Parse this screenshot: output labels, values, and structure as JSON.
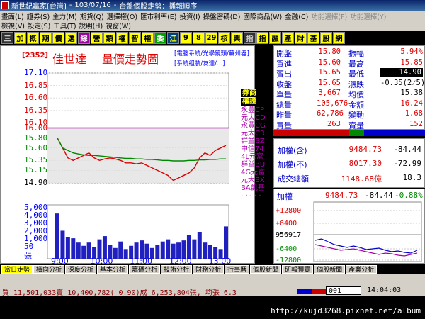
{
  "window": {
    "title": "新世紀贏家",
    "market": "[台灣]",
    "date": "103/07/16",
    "subtitle": "台盤個股走勢：播報順序"
  },
  "menu": {
    "row1": [
      "畫面(L)",
      "證券(S)",
      "主力(M)",
      "期貨(Q)",
      "選擇權(O)",
      "匯市利率(E)",
      "投資(I)",
      "操盤密碼(D)",
      "國際商品(W)",
      "金融(C)",
      "功能選擇(F)",
      "功能選擇(Y)"
    ],
    "row2": [
      "檢視(V)",
      "設定(S)",
      "工具(T)",
      "說明(H)",
      "視窗(W)"
    ]
  },
  "toolbar": [
    "三",
    "加",
    "概",
    "期",
    "價",
    "選",
    "綜",
    "營",
    "類",
    "權",
    "智",
    "權",
    "委",
    "江",
    "9",
    "8",
    "29",
    "核",
    "興",
    "指",
    "指",
    "融",
    "產",
    "財",
    "基",
    "股",
    "網"
  ],
  "stock": {
    "id": "[2352]",
    "name": "佳世達",
    "chart_title": "量價走勢圖",
    "links": [
      "[電腦系統/光學鏡頭/蘇州器]",
      "[系統組裝/友達/...]"
    ]
  },
  "quote": {
    "rows": [
      {
        "l1": "開盤",
        "v1": "15.80",
        "l2": "振幅",
        "v2": "5.94%"
      },
      {
        "l1": "買進",
        "v1": "15.60",
        "l2": "最高",
        "v2": "15.85"
      },
      {
        "l1": "賣出",
        "v1": "15.65",
        "l2": "最低",
        "v2": "14.90"
      },
      {
        "l1": "收盤",
        "v1": "15.65",
        "l2": "漲跌",
        "v2": "-0.35(2⁄5)"
      },
      {
        "l1": "單量",
        "v1": "3,667",
        "l2": "均價",
        "v2": "15.38"
      },
      {
        "l1": "總量",
        "v1": "105,676",
        "l2": "金額",
        "v2": "16.24"
      },
      {
        "l1": "昨量",
        "v1": "62,786",
        "l2": "變動",
        "v2": "1.68"
      },
      {
        "l1": "買量",
        "v1": "263",
        "l2": "賣量",
        "v2": "152"
      }
    ]
  },
  "index": {
    "rows": [
      {
        "label": "加權(含)",
        "value": "9484.73",
        "change": "-84.44"
      },
      {
        "label": "加權(不)",
        "value": "8017.30",
        "change": "-72.99"
      },
      {
        "label": "成交總額",
        "value": "1148.68億",
        "change": "18.3"
      }
    ]
  },
  "mini": {
    "label": "加權",
    "value": "9484.73",
    "change": "-84.44",
    "pct": "-0.88%",
    "ylabels": [
      "+12800",
      "+6400",
      "956917",
      "-6400",
      "-12800"
    ]
  },
  "brokers": {
    "header1": "券商",
    "header2": "權證",
    "list": [
      "永豐CP",
      "元大CD",
      "永豐CG",
      "元大CR",
      "群益BZ",
      "中信74",
      "4L元富",
      "群益BU",
      "4G元富",
      "元大BX",
      "BA凱基",
      "· · · · ·"
    ]
  },
  "tabs": [
    "當日走勢",
    "橫向分析",
    "深度分析",
    "基本分析",
    "籌碼分析",
    "技術分析",
    "財務分析",
    "行事曆",
    "個股新聞",
    "研報預覽",
    "個股新聞",
    "產業分析"
  ],
  "status": {
    "text": "買 11,501,033賣 10,400,782( 0.90)成 6,253,804張, 均張 6.3",
    "code": "001",
    "time": "14:04:03"
  },
  "watermark": "http://kujd3268.pixnet.net/album",
  "chart_data": {
    "type": "line",
    "x_ticks": [
      "9:00",
      "10:00",
      "11:00",
      "12:00",
      "13:00"
    ],
    "price_ticks": [
      "17.10",
      "16.85",
      "16.60",
      "16.35",
      "16.10",
      "16.00",
      "15.80",
      "15.60",
      "15.35",
      "15.15",
      "14.90"
    ],
    "volume_ticks": [
      "5,000",
      "4,000",
      "3,000",
      "2,000",
      "1,000",
      "50",
      "張"
    ],
    "reference_price": 16.0,
    "ylim": [
      14.9,
      17.1
    ],
    "series": [
      {
        "values": [
          15.8,
          15.6,
          15.4,
          15.35,
          15.4,
          15.45,
          15.5,
          15.4,
          15.35,
          15.38,
          15.4,
          15.38,
          15.35,
          15.3,
          15.3,
          15.28,
          15.3,
          15.25,
          15.2,
          15.15,
          15.1,
          15.05,
          14.95,
          15.0,
          15.05,
          15.1,
          15.2,
          15.4,
          15.5,
          15.45,
          15.55,
          15.6,
          15.65
        ]
      },
      {
        "values": [
          15.8,
          15.6,
          15.55,
          15.5,
          15.48,
          15.46,
          15.45,
          15.45,
          15.44,
          15.43,
          15.42,
          15.41,
          15.4,
          15.39,
          15.39,
          15.38,
          15.38,
          15.37,
          15.37,
          15.36,
          15.35,
          15.35,
          15.34,
          15.34,
          15.34,
          15.35,
          15.35,
          15.36,
          15.36,
          15.37,
          15.37,
          15.38,
          15.38
        ]
      }
    ],
    "volume": [
      4200,
      2600,
      2000,
      1900,
      1500,
      1200,
      1500,
      1100,
      1800,
      2100,
      1300,
      1000,
      1600,
      900,
      1200,
      1500,
      1700,
      1400,
      1000,
      1300,
      1600,
      1800,
      1400,
      1500,
      1700,
      2200,
      1800,
      2500,
      1500,
      1300,
      1100,
      900,
      3000
    ],
    "volume_max": 5000
  }
}
